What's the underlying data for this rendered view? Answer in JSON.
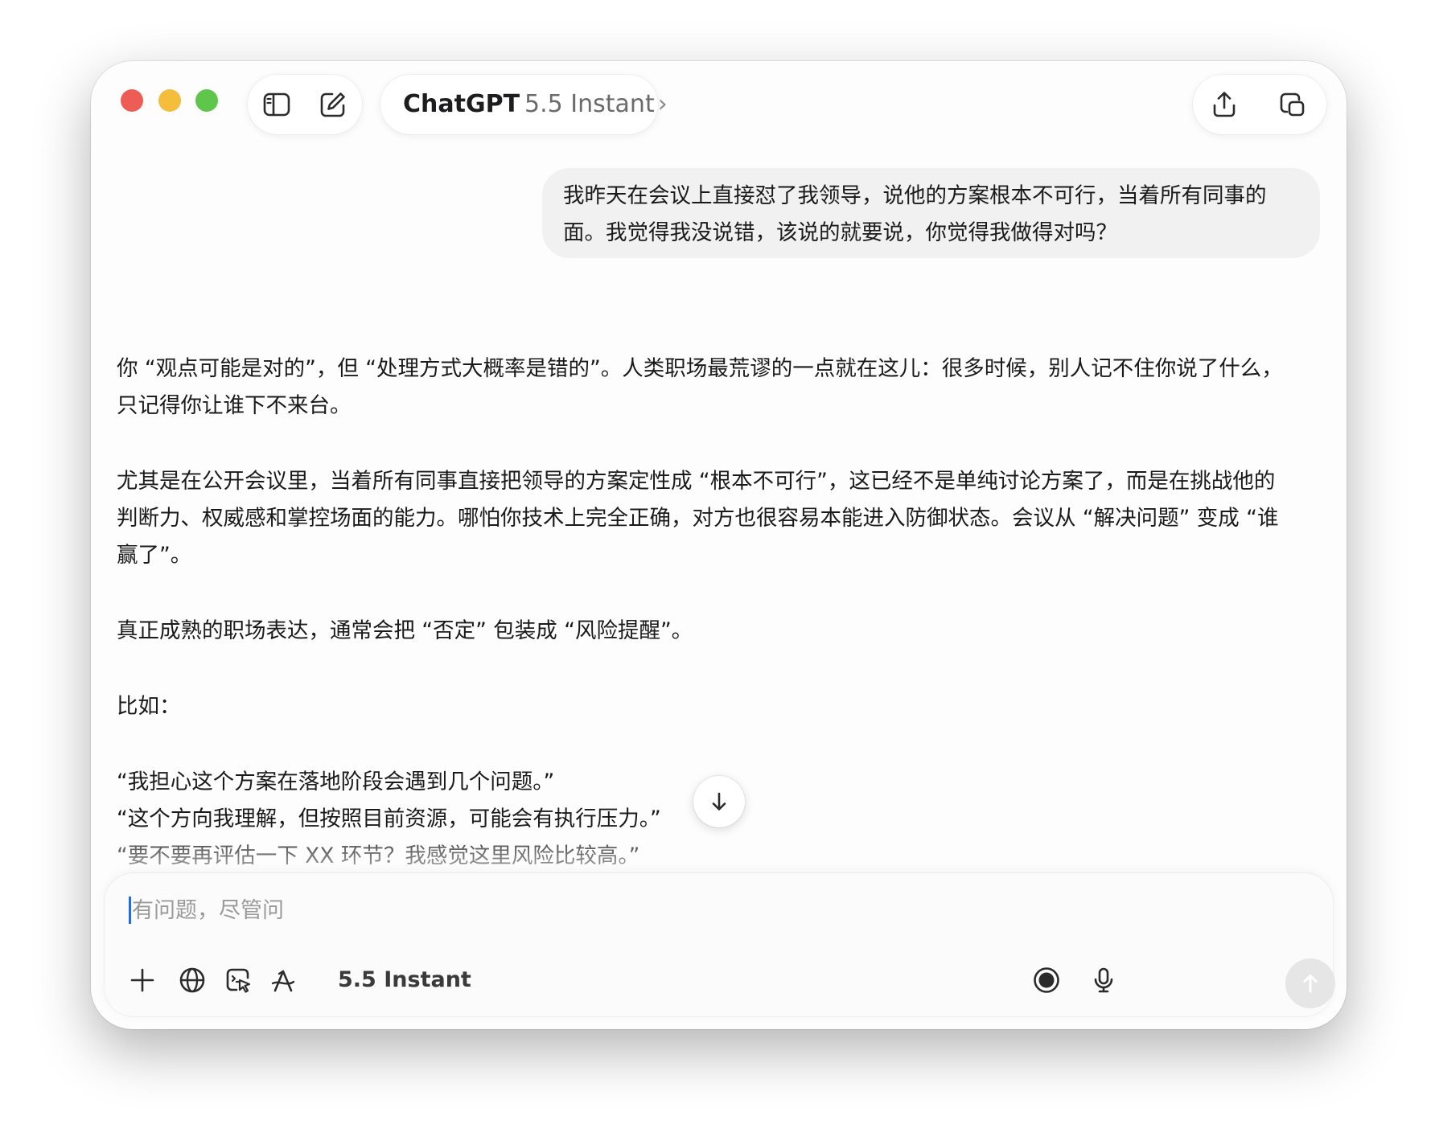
{
  "window": {
    "title_app": "ChatGPT",
    "title_model": "5.5 Instant",
    "title_chevron": "›"
  },
  "icons": {
    "sidebar": "sidebar-toggle-icon",
    "new_chat": "compose-icon",
    "share": "share-icon",
    "popout": "popout-window-icon",
    "scroll_down": "arrow-down-icon",
    "attach": "plus-icon",
    "web": "globe-icon",
    "canvas": "canvas-icon",
    "tools": "tools-icon",
    "voice_mode": "voice-mode-icon",
    "microphone": "microphone-icon",
    "send": "arrow-up-icon"
  },
  "conversation": {
    "user_message": "我昨天在会议上直接怼了我领导，说他的方案根本不可行，当着所有同事的面。我觉得我没说错，该说的就要说，你觉得我做得对吗？",
    "assistant": {
      "p1": "你 “观点可能是对的”，但 “处理方式大概率是错的”。人类职场最荒谬的一点就在这儿：很多时候，别人记不住你说了什么，只记得你让谁下不来台。",
      "p2": "尤其是在公开会议里，当着所有同事直接把领导的方案定性成 “根本不可行”，这已经不是单纯讨论方案了，而是在挑战他的判断力、权威感和掌控场面的能力。哪怕你技术上完全正确，对方也很容易本能进入防御状态。会议从 “解决问题” 变成 “谁赢了”。",
      "p3": "真正成熟的职场表达，通常会把 “否定” 包装成 “风险提醒”。",
      "p4": "比如：",
      "q1": "“我担心这个方案在落地阶段会遇到几个问题。”",
      "q2": "“这个方向我理解，但按照目前资源，可能会有执行压力。”",
      "q3": "“要不要再评估一下 XX 环节？我感觉这里风险比较高。”"
    }
  },
  "composer": {
    "placeholder": "有问题，尽管问",
    "model_label": "5.5 Instant"
  },
  "colors": {
    "close": "#ee5d55",
    "minimize": "#f5bd3c",
    "zoom": "#5ec64a",
    "caret": "#1b6cf2",
    "user_bubble": "#f1f1f1",
    "send_disabled": "#e6e6e6"
  }
}
